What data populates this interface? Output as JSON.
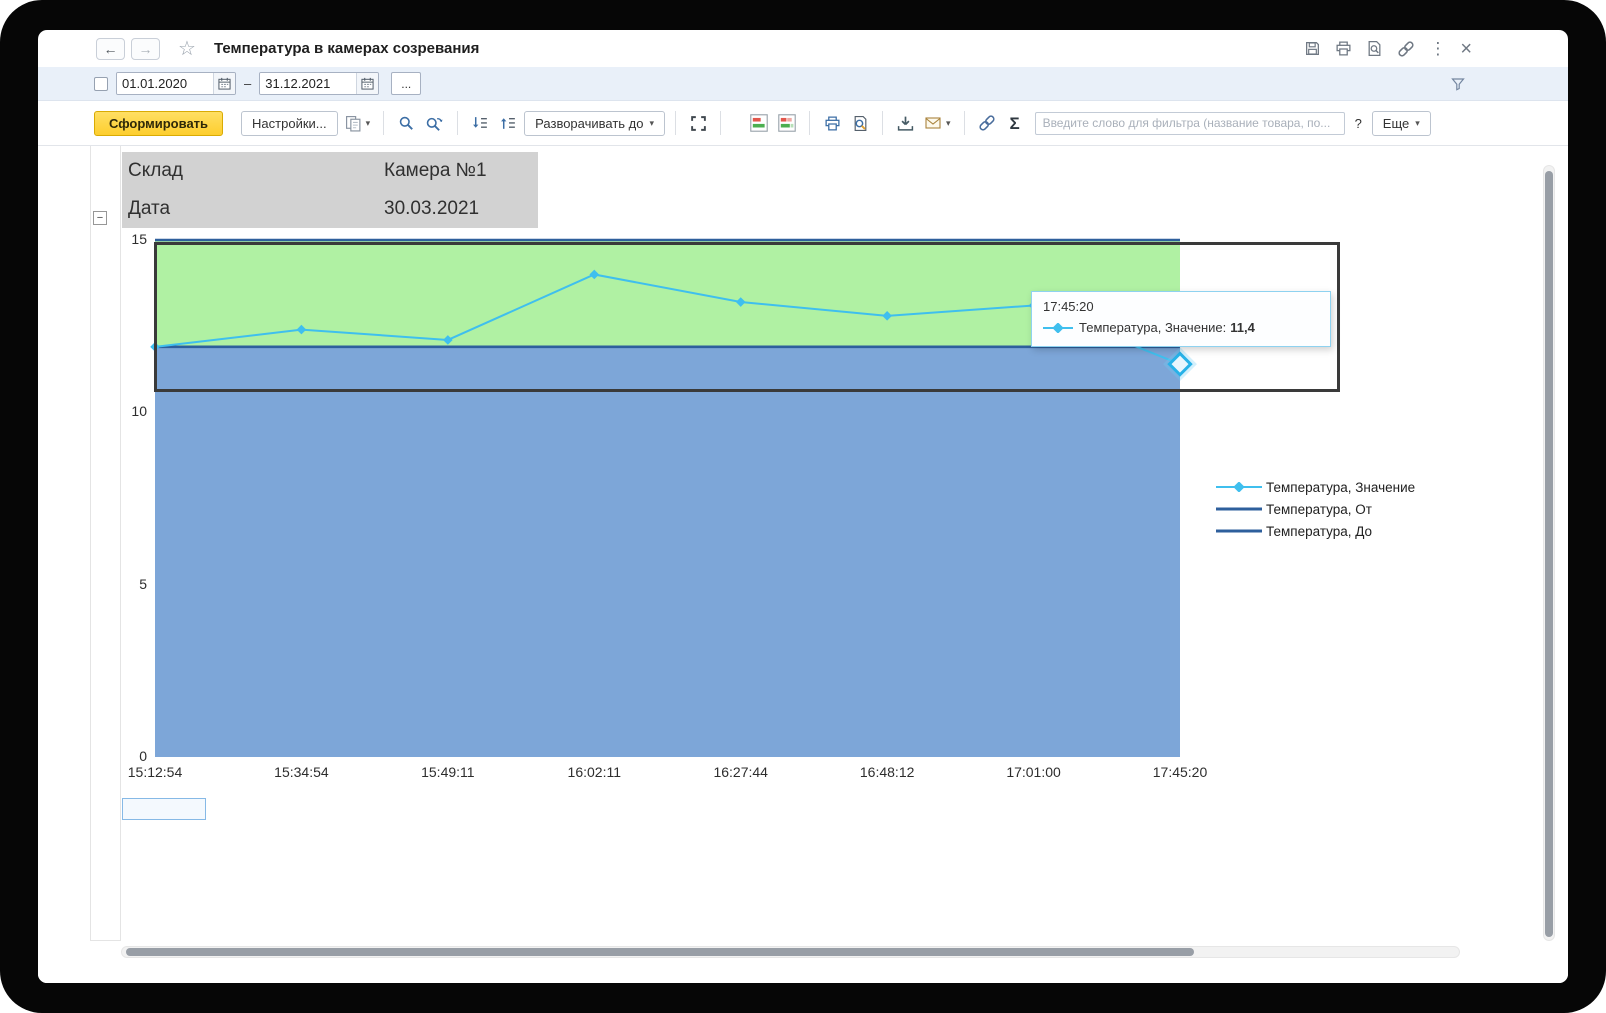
{
  "window": {
    "title": "Температура в камерах созревания"
  },
  "glyphs": {
    "back": "←",
    "forward": "→",
    "star": "☆",
    "menu": "⋮",
    "close": "×",
    "caret": "▾",
    "minus": "−"
  },
  "filter_row": {
    "date_from": "01.01.2020",
    "date_to": "31.12.2021",
    "range_separator": "–",
    "more_dates": "..."
  },
  "toolbar": {
    "generate": "Сформировать",
    "settings": "Настройки...",
    "expand_to": "Разворачивать до",
    "sigma": "Σ",
    "filter_placeholder": "Введите слово для фильтра (название товара, по...",
    "help": "?",
    "more": "Еще"
  },
  "report_header": {
    "rows": [
      {
        "label": "Склад",
        "value": "Камера №1"
      },
      {
        "label": "Дата",
        "value": "30.03.2021"
      }
    ]
  },
  "tooltip": {
    "time": "17:45:20",
    "series_label": "Температура, Значение:",
    "value": "11,4"
  },
  "chart_data": {
    "type": "line",
    "categories": [
      "15:12:54",
      "15:34:54",
      "15:49:11",
      "16:02:11",
      "16:27:44",
      "16:48:12",
      "17:01:00",
      "17:45:20"
    ],
    "series": [
      {
        "name": "Температура, Значение",
        "color": "#3fbfee",
        "marker": "diamond",
        "values": [
          11.9,
          12.4,
          12.1,
          14.0,
          13.2,
          12.8,
          13.1,
          11.4
        ]
      },
      {
        "name": "Температура, От",
        "color": "#2e5f9c",
        "values": [
          11.9,
          11.9,
          11.9,
          11.9,
          11.9,
          11.9,
          11.9,
          11.9
        ]
      },
      {
        "name": "Температура, До",
        "color": "#2e5f9c",
        "values": [
          15,
          15,
          15,
          15,
          15,
          15,
          15,
          15
        ]
      }
    ],
    "ylim": [
      0,
      15
    ],
    "yticks": [
      0,
      5,
      10,
      15
    ],
    "bands": [
      {
        "from": 11.9,
        "to": 15,
        "color": "#b0f1a3"
      },
      {
        "from": 0,
        "to": 11.9,
        "color": "#7da6d8"
      }
    ],
    "highlight_point": {
      "category": "17:45:20",
      "value": 11.4
    },
    "legend_position": "right",
    "grid": false
  }
}
